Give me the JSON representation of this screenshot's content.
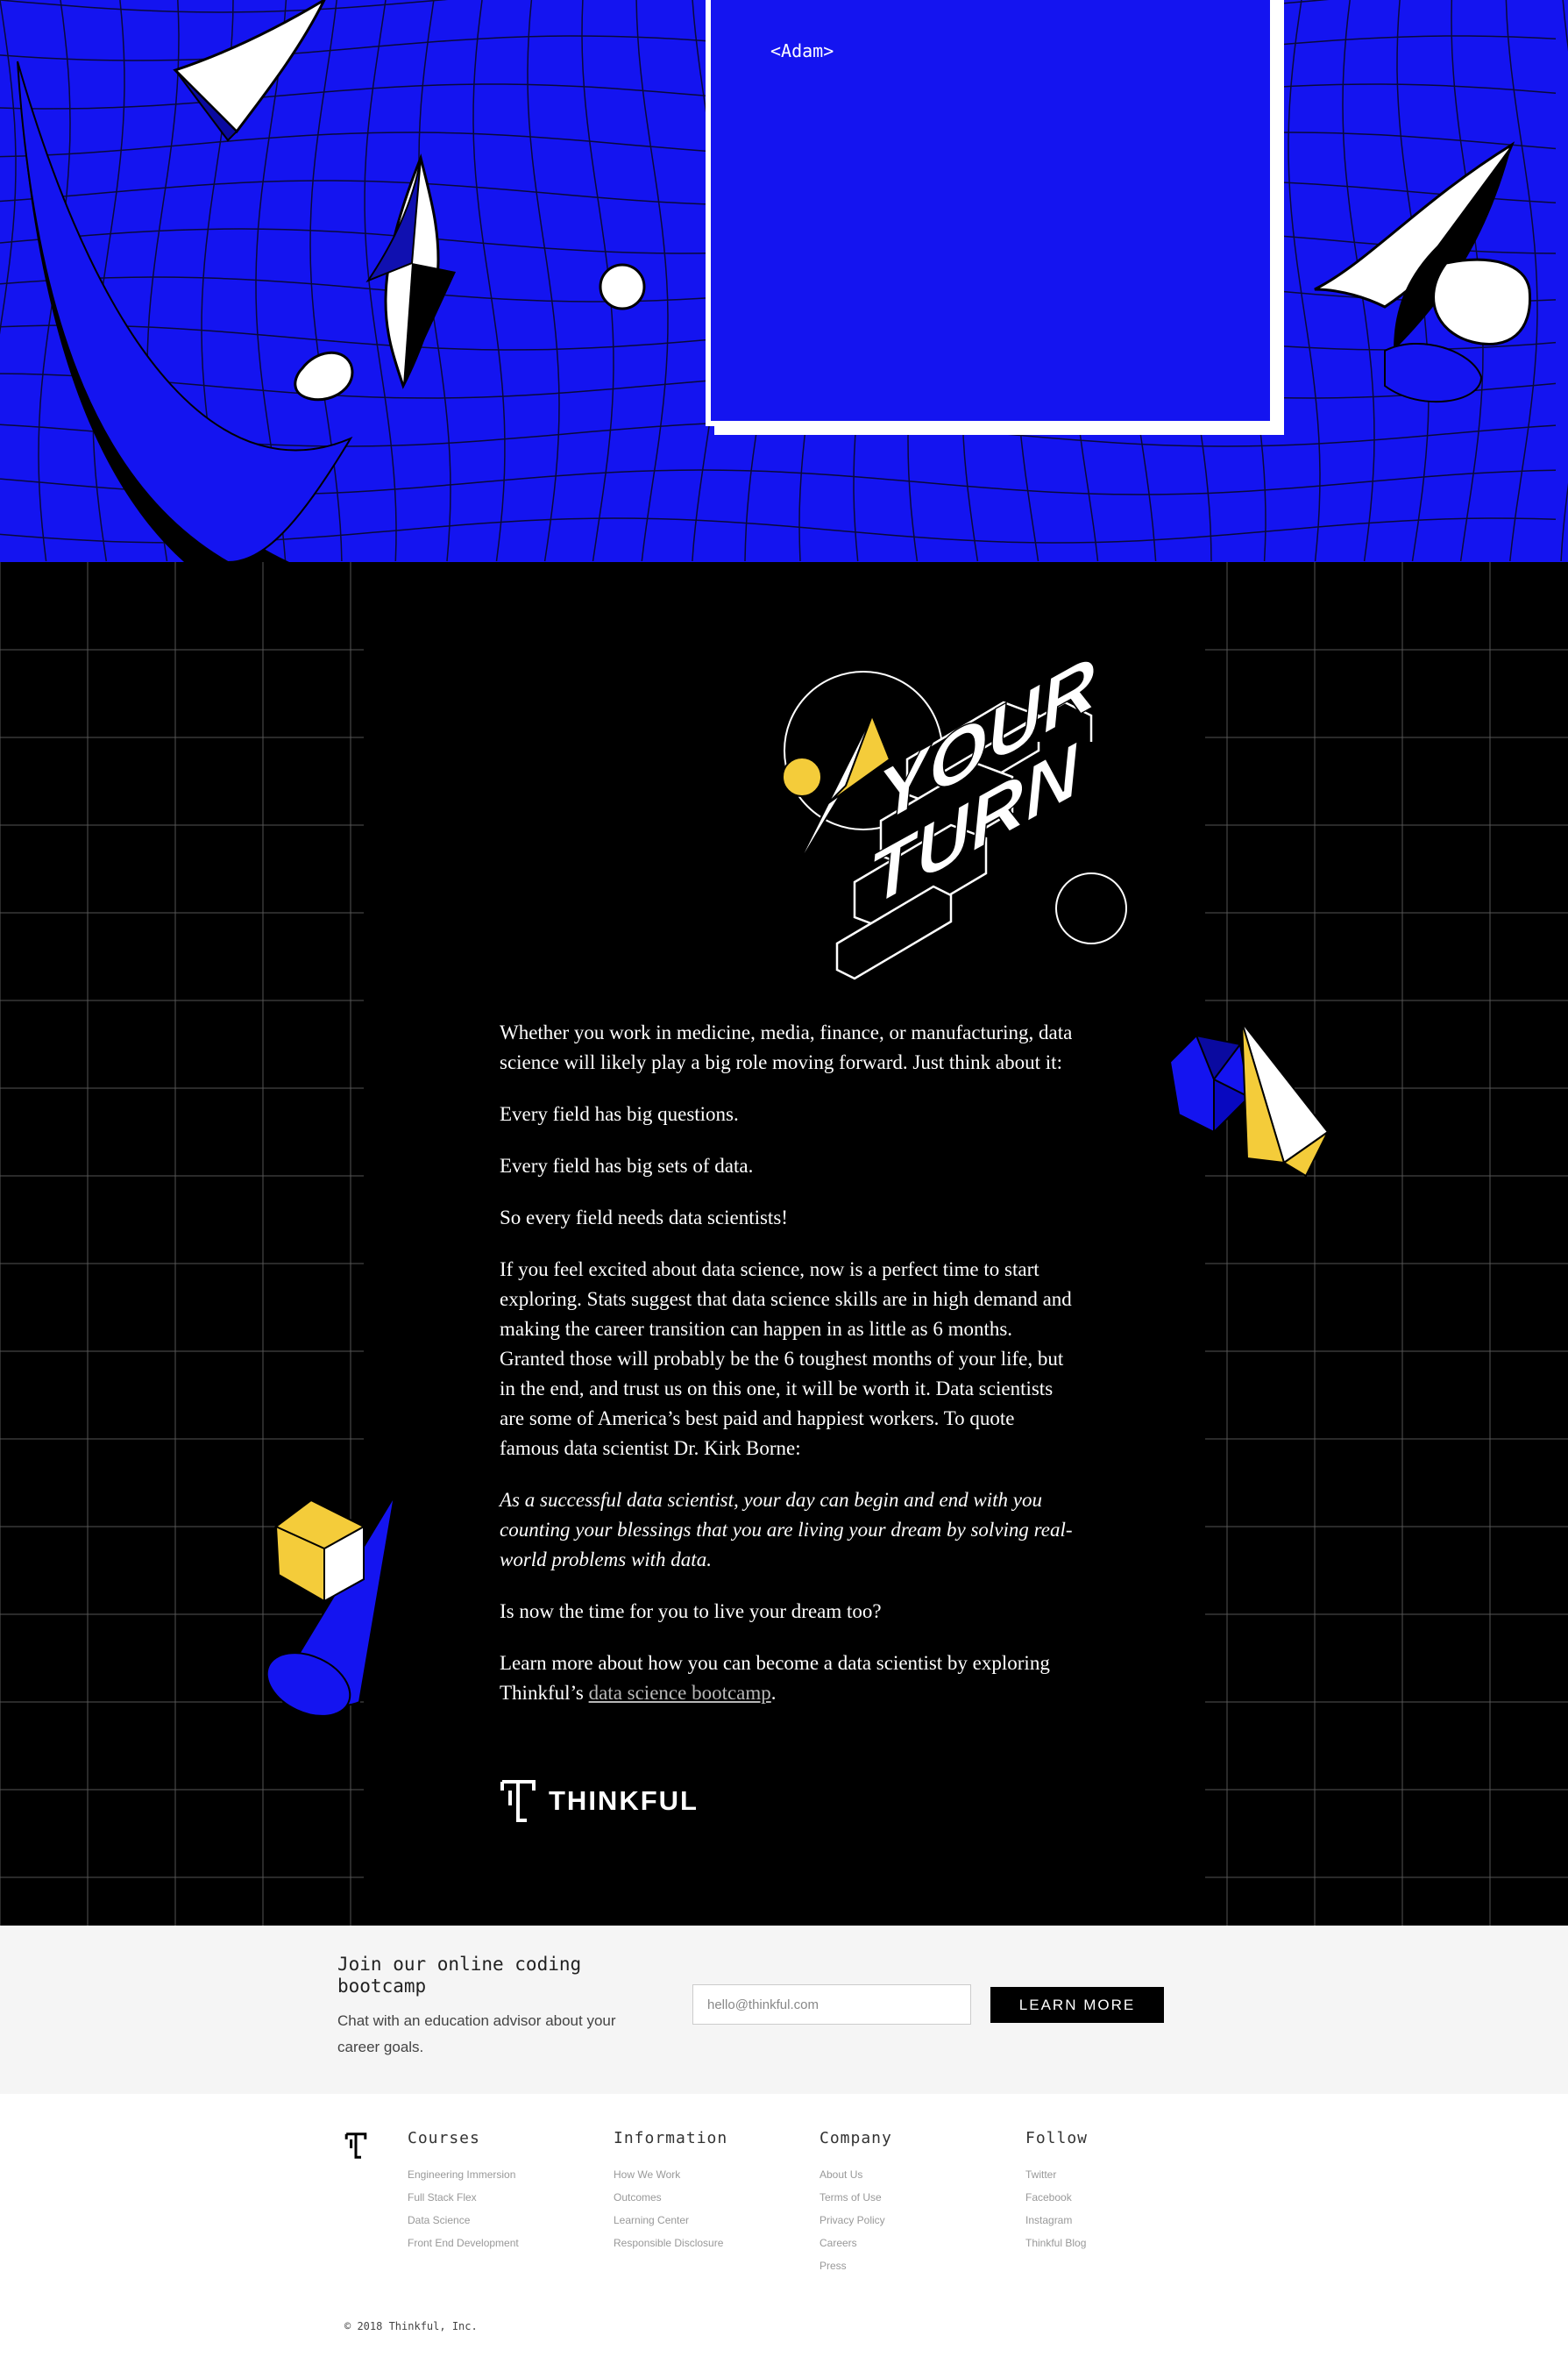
{
  "hero": {
    "quote_author": "<Adam>"
  },
  "article": {
    "heading_line1": "YOUR",
    "heading_line2": "TURN",
    "paragraphs": [
      "Whether you work in medicine, media, finance, or manufacturing, data science will likely play a big role moving forward. Just think about it:",
      "Every field has big questions.",
      "Every field has big sets of data.",
      "So every field needs data scientists!",
      "If you feel excited about data science, now is a perfect time to start exploring. Stats suggest that data science skills are in high demand and making the career transition can happen in as little as 6 months. Granted those will probably be the 6 toughest months of your life, but in the end, and trust us on this one, it will be worth it. Data scientists are some of America’s best paid and happiest workers. To quote famous data scientist Dr. Kirk Borne:"
    ],
    "quote": "As a successful data scientist, your day can begin and end with you counting your blessings that you are living your dream by solving real-world problems with data.",
    "question": "Is now the time for you to live your dream too?",
    "cta_prefix": "Learn more about how you can become a data scientist by exploring Thinkful’s",
    "cta_link": "data science bootcamp",
    "cta_suffix": ".",
    "logo_text": "THINKFUL"
  },
  "signup": {
    "title": "Join our online coding bootcamp",
    "subtitle": "Chat with an education advisor about your career goals.",
    "email_placeholder": "hello@thinkful.com",
    "button_label": "LEARN MORE"
  },
  "footer": {
    "columns": [
      {
        "title": "Courses",
        "items": [
          "Engineering Immersion",
          "Full Stack Flex",
          "Data Science",
          "Front End Development"
        ]
      },
      {
        "title": "Information",
        "items": [
          "How We Work",
          "Outcomes",
          "Learning Center",
          "Responsible Disclosure"
        ]
      },
      {
        "title": "Company",
        "items": [
          "About Us",
          "Terms of Use",
          "Privacy Policy",
          "Careers",
          "Press"
        ]
      },
      {
        "title": "Follow",
        "items": [
          "Twitter",
          "Facebook",
          "Instagram",
          "Thinkful Blog"
        ]
      }
    ],
    "copyright": "© 2018 Thinkful, Inc."
  },
  "colors": {
    "brand_blue": "#1414f0",
    "accent_yellow": "#f4cc3a",
    "dark_bg": "#000000"
  }
}
